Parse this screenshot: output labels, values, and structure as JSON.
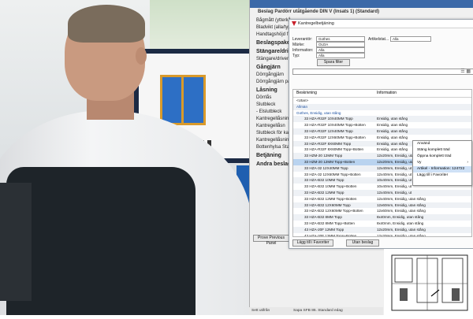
{
  "app": {
    "left_panel": {
      "title": "Beslag Pardörr utåtgående DIN V (Insats 1) (Standard)",
      "items": [
        {
          "label": "Bågmått (ytterkå",
          "type": "item"
        },
        {
          "label": "Bladvikt (alla/typ",
          "type": "item"
        },
        {
          "label": "Handtagshöjd f",
          "type": "item"
        },
        {
          "label": "Beslagspaket",
          "type": "header"
        },
        {
          "label": "Stängare/driv",
          "type": "header"
        },
        {
          "label": "Stängare/drivenh",
          "type": "item"
        },
        {
          "label": "Gångjärn",
          "type": "header"
        },
        {
          "label": "Dörrgångjärn",
          "type": "item"
        },
        {
          "label": "Dörrgångjärn pass",
          "type": "item"
        },
        {
          "label": "Låsning",
          "type": "header"
        },
        {
          "label": "Dörrlås",
          "type": "item"
        },
        {
          "label": "Slutbleck",
          "type": "item"
        },
        {
          "label": "- Elslutbleck",
          "type": "item"
        },
        {
          "label": "Kantregellåsning",
          "type": "item"
        },
        {
          "label": "Kantregellåsn",
          "type": "item"
        },
        {
          "label": "Slutbleck för kant",
          "type": "item"
        },
        {
          "label": "Kantregellåsning",
          "type": "item"
        },
        {
          "label": "Bottenhylsa Stand",
          "type": "item"
        },
        {
          "label": "Betjäning",
          "type": "header"
        },
        {
          "label": "Andra beslag",
          "type": "header"
        }
      ],
      "prev_button": "Prove Previous Panel"
    },
    "status_left": "Sett utifrån",
    "status_right": "Sapa SFB 86. Standard edag"
  },
  "dialog": {
    "title": "Kantregelbetjäning",
    "filters": [
      {
        "label": "Leverantör:",
        "value": "Gothes"
      },
      {
        "label": "Märke:",
        "value": "OLDA"
      },
      {
        "label": "Information:",
        "value": "Alla"
      },
      {
        "label": "Typ:",
        "value": "Alla"
      }
    ],
    "article_label": "Artikelstat...",
    "article_value": "Alla",
    "save_filter": "Spara filter",
    "columns": {
      "desc": "Beskrivning",
      "info": "Information"
    },
    "rows": [
      {
        "d": "<Utan>",
        "i": "",
        "kind": "plain"
      },
      {
        "d": "Allmän",
        "i": "",
        "kind": "group"
      },
      {
        "d": "Gothes, Ensidig, utan stång",
        "i": "",
        "kind": "group"
      },
      {
        "d": "33 HZA-R32F 10X40MM Topp",
        "i": "Ensidig, utan stång",
        "kind": "row"
      },
      {
        "d": "33 HZA-R32F 10X40MM Topp+Botten",
        "i": "Ensidig, utan stång",
        "kind": "row"
      },
      {
        "d": "33 HZA-R32F 12X40MM Topp",
        "i": "Ensidig, utan stång",
        "kind": "row"
      },
      {
        "d": "33 HZA-R32F 12X60MM Topp+Botten",
        "i": "Ensidig, utan stång",
        "kind": "row"
      },
      {
        "d": "33 HZA-R32F 8X60MM Topp",
        "i": "Ensidig, utan stång",
        "kind": "row"
      },
      {
        "d": "33 HZA-R32F 8X60MM Topp+Botten",
        "i": "Ensidig, utan stång",
        "kind": "row"
      },
      {
        "d": "33 HZM-20 12MM Topp",
        "i": "12x20mm, Ensidig, utan stång",
        "kind": "row"
      },
      {
        "d": "33 HZM-20 12MM Topp+Botten",
        "i": "12x20mm, Ensidig, utan stång",
        "kind": "hl"
      },
      {
        "d": "33 HZA-32 12X40MM Topp",
        "i": "12x40mm, Ensidig, ut",
        "kind": "row"
      },
      {
        "d": "33 HZA-32 12X60MM Topp+Botten",
        "i": "12x40mm, Ensidig, ut",
        "kind": "row"
      },
      {
        "d": "33 HZA-B32 10MM Topp",
        "i": "10x40mm, Ensidig, ut",
        "kind": "row"
      },
      {
        "d": "33 HZA-B32 10MM Topp+Botten",
        "i": "10x40mm, Ensidig, ut",
        "kind": "row"
      },
      {
        "d": "33 HZA-B32 12MM Topp",
        "i": "12x40mm, Ensidig, ut",
        "kind": "row"
      },
      {
        "d": "33 HZA-B32 12MM Topp+Botten",
        "i": "12x40mm, Ensidig, utan stång",
        "kind": "row"
      },
      {
        "d": "33 HZA-B32 12X60MM Topp",
        "i": "12x60mm, Ensidig, utan stång",
        "kind": "row"
      },
      {
        "d": "33 HZA-B32 12X60MM Topp+Botten",
        "i": "12x60mm, Ensidig, utan stång",
        "kind": "row"
      },
      {
        "d": "33 HZA-B32 8MM Topp",
        "i": "8x40mm, Ensidig, utan stång",
        "kind": "row"
      },
      {
        "d": "33 HZA-B32 8MM Topp+Botten",
        "i": "8x40mm, Ensidig, utan stång",
        "kind": "row"
      },
      {
        "d": "43 HZA-20F 12MM Topp",
        "i": "12x20mm, Ensidig, utan stång",
        "kind": "row"
      },
      {
        "d": "43 HZA-20F 12MM Topp+Botten",
        "i": "12x20mm, Ensidig, utan stång",
        "kind": "row"
      },
      {
        "d": "43 HZA-32F 12X40MM Topp",
        "i": "Ensidig, utan stång",
        "kind": "row"
      },
      {
        "d": "43 HZA-32F 12X60MM Topp+Botten",
        "i": "Ensidig, utan stång",
        "kind": "row"
      },
      {
        "d": "602 HZA",
        "i": "Toppförregling Pacont blad, Ensidig, utan stång",
        "kind": "row"
      }
    ],
    "add_favorites": "Lägg till i Favoriter",
    "without_fitting": "Utan beslag"
  },
  "context_menu": {
    "items": [
      {
        "label": "Använd",
        "selected": false
      },
      {
        "label": "Stäng komplett träd",
        "selected": false
      },
      {
        "label": "Öppna komplett träd",
        "selected": false
      },
      {
        "label": "Vy",
        "selected": false,
        "arrow": "›"
      },
      {
        "label": "Artikel - Information: 124722",
        "selected": true
      },
      {
        "label": "Lägg till i Favoriter",
        "selected": false
      }
    ]
  }
}
